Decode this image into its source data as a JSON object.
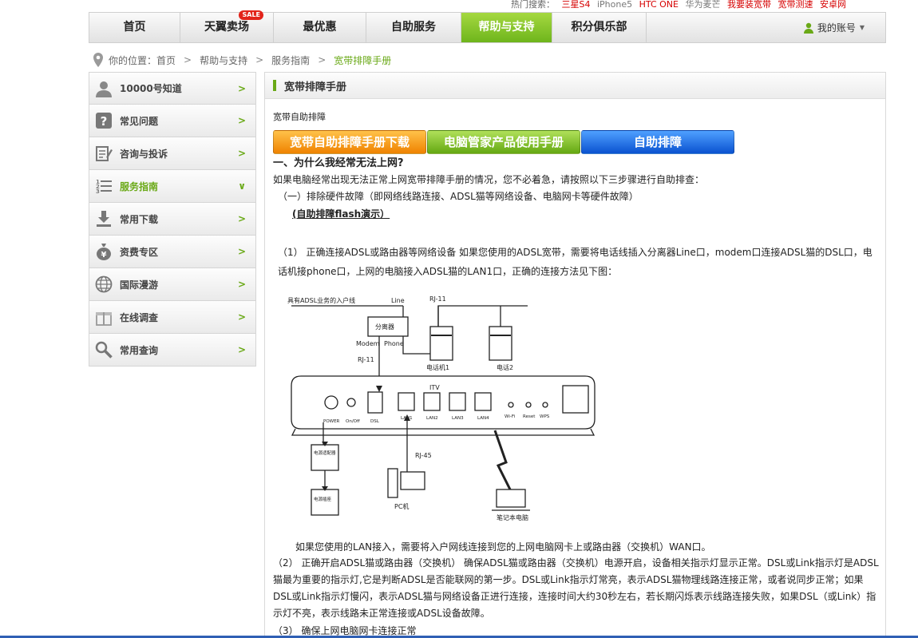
{
  "hot_search": {
    "label": "热门搜索：",
    "terms": [
      {
        "text": "三星S4",
        "color": "#d60000"
      },
      {
        "text": "iPhone5",
        "color": "#777777"
      },
      {
        "text": "HTC ONE",
        "color": "#d60000"
      },
      {
        "text": "华为麦芒",
        "color": "#777777"
      },
      {
        "text": "我要装宽带",
        "color": "#d60000"
      },
      {
        "text": "宽带测速",
        "color": "#d60000"
      },
      {
        "text": "安卓网",
        "color": "#d60000"
      }
    ]
  },
  "nav": {
    "items": [
      {
        "label": "首页",
        "width": 114
      },
      {
        "label": "天翼卖场",
        "badge": "SALE",
        "width": 117
      },
      {
        "label": "最优惠",
        "width": 116
      },
      {
        "label": "自助服务",
        "width": 119
      },
      {
        "label": "帮助与支持",
        "active": true,
        "width": 114
      },
      {
        "label": "积分俱乐部",
        "width": 118
      }
    ],
    "account": "我的账号"
  },
  "breadcrumb": {
    "prefix": "你的位置：",
    "items": [
      "首页",
      "帮助与支持",
      "服务指南"
    ],
    "current": "宽带排障手册"
  },
  "sidebar": {
    "items": [
      {
        "label": "10000号知道",
        "icon": "person-icon"
      },
      {
        "label": "常见问题",
        "icon": "question-icon"
      },
      {
        "label": "咨询与投诉",
        "icon": "edit-icon"
      },
      {
        "label": "服务指南",
        "icon": "list-icon",
        "active": true
      },
      {
        "label": "常用下载",
        "icon": "download-icon"
      },
      {
        "label": "资费专区",
        "icon": "money-bag-icon"
      },
      {
        "label": "国际漫游",
        "icon": "globe-icon"
      },
      {
        "label": "在线调查",
        "icon": "gift-icon"
      },
      {
        "label": "常用查询",
        "icon": "magnifier-icon"
      }
    ]
  },
  "content": {
    "title": "宽带排障手册",
    "subtitle": "宽带自助排障",
    "buttons": {
      "download": "宽带自助排障手册下载",
      "manual": "电脑管家产品使用手册",
      "self_check": "自助排障"
    },
    "q_title": "一、为什么我经常无法上网?",
    "p1": "如果电脑经常出现无法正常上网宽带排障手册的情况，您不必着急，请按照以下三步骤进行自助排查：",
    "p2": "（一）排除硬件故障（即网络线路连接、ADSL猫等网络设备、电脑网卡等硬件故障）",
    "flash_link": "(自助排障flash演示）",
    "p4": "（1） 正确连接ADSL或路由器等网络设备 如果您使用的ADSL宽带，需要将电话线插入分离器Line口，modem口连接ADSL猫的DSL口，电话机接phone口，上网的电脑接入ADSL猫的LAN1口，正确的连接方法见下图：",
    "p5": "如果您使用的LAN接入，需要将入户网线连接到您的上网电脑网卡上或路由器（交换机）WAN口。",
    "p6": "（2） 正确开启ADSL猫或路由器（交换机） 确保ADSL猫或路由器（交换机）电源开启，设备相关指示灯显示正常。DSL或Link指示灯是ADSL猫最为重要的指示灯,它是判断ADSL是否能联网的第一步。DSL或Link指示灯常亮，表示ADSL猫物理线路连接正常，或者说同步正常；如果DSL或Link指示灯慢闪，表示ADSL猫与网络设备正进行连接，连接时间大约30秒左右，若长期闪烁表示线路连接失败，如果DSL（或Link）指示灯不亮，表示线路未正常连接或ADSL设备故障。",
    "p7": "（3） 确保上网电脑网卡连接正常"
  },
  "diagram": {
    "incoming": "具有ADSL业务的入户线",
    "line": "Line",
    "rj11_top": "RJ-11",
    "splitter": "分离器",
    "modem": "Modem",
    "phone": "Phone",
    "rj11_left": "RJ-11",
    "phone1": "电话机1",
    "phone2": "电话2",
    "ports": [
      "POWER",
      "On/Off",
      "DSL",
      "LAN1",
      "LAN2",
      "LAN3",
      "LAN4",
      "Wi-Fi",
      "Reset",
      "WPS"
    ],
    "itv": "ITV",
    "adapter": "电源适配器",
    "socket": "电源插座",
    "rj45": "RJ-45",
    "pc": "PC机",
    "laptop": "笔记本电脑"
  }
}
